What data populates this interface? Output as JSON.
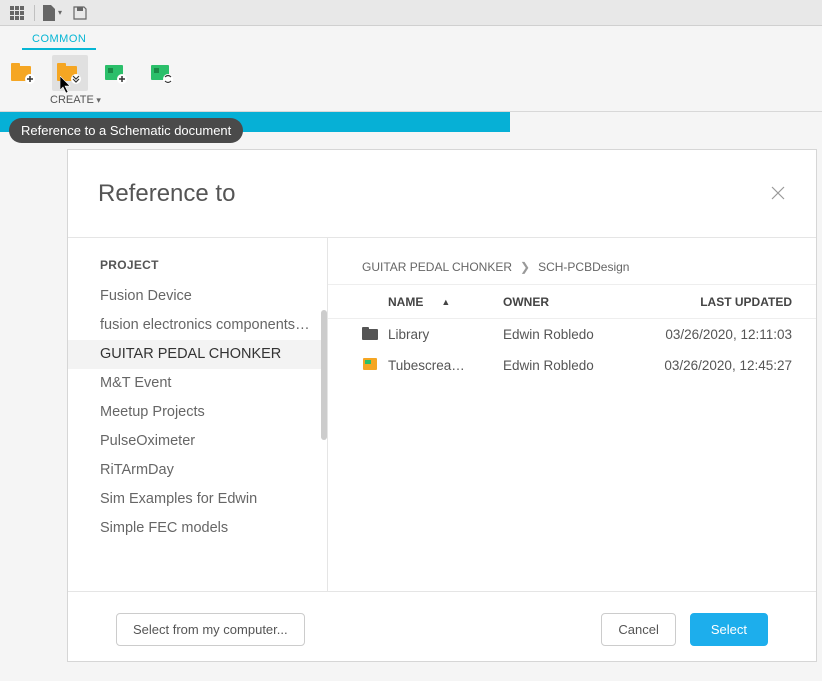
{
  "toolbar": {
    "tab_label": "COMMON",
    "create_label": "CREATE"
  },
  "tooltip": "Reference to a Schematic document",
  "dialog": {
    "title": "Reference to",
    "sidebar": {
      "heading": "PROJECT",
      "items": [
        {
          "label": "Fusion Device"
        },
        {
          "label": "fusion electronics components ..."
        },
        {
          "label": "GUITAR PEDAL CHONKER",
          "selected": true
        },
        {
          "label": "M&T Event"
        },
        {
          "label": "Meetup Projects"
        },
        {
          "label": "PulseOximeter"
        },
        {
          "label": "RiTArmDay"
        },
        {
          "label": "Sim Examples for Edwin"
        },
        {
          "label": "Simple FEC models"
        }
      ]
    },
    "breadcrumb": [
      "GUITAR PEDAL CHONKER",
      "SCH-PCBDesign"
    ],
    "columns": {
      "name": "NAME",
      "owner": "OWNER",
      "updated": "LAST UPDATED"
    },
    "rows": [
      {
        "icon": "folder",
        "name": "Library",
        "owner": "Edwin Robledo",
        "updated": "03/26/2020, 12:11:03"
      },
      {
        "icon": "doc",
        "name": "Tubescrea…",
        "owner": "Edwin Robledo",
        "updated": "03/26/2020, 12:45:27"
      }
    ],
    "footer": {
      "select_from": "Select from my computer...",
      "cancel": "Cancel",
      "select": "Select"
    }
  }
}
